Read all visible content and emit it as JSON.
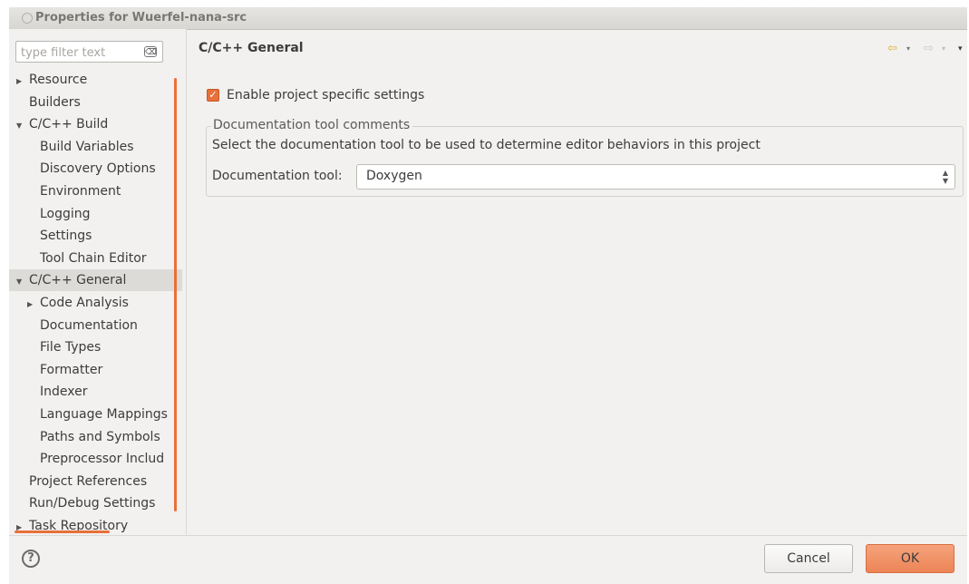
{
  "window": {
    "title": "Properties for Wuerfel-nana-src"
  },
  "filter": {
    "placeholder": "type filter text",
    "clear_glyph": "⌫"
  },
  "tree": [
    {
      "label": "Resource",
      "expander": "collapsed",
      "level": 0
    },
    {
      "label": "Builders",
      "expander": "none",
      "level": 0
    },
    {
      "label": "C/C++ Build",
      "expander": "expanded",
      "level": 0
    },
    {
      "label": "Build Variables",
      "expander": "none",
      "level": 1
    },
    {
      "label": "Discovery Options",
      "expander": "none",
      "level": 1
    },
    {
      "label": "Environment",
      "expander": "none",
      "level": 1
    },
    {
      "label": "Logging",
      "expander": "none",
      "level": 1
    },
    {
      "label": "Settings",
      "expander": "none",
      "level": 1
    },
    {
      "label": "Tool Chain Editor",
      "expander": "none",
      "level": 1
    },
    {
      "label": "C/C++ General",
      "expander": "expanded",
      "level": 0,
      "selected": true
    },
    {
      "label": "Code Analysis",
      "expander": "collapsed",
      "level": 1
    },
    {
      "label": "Documentation",
      "expander": "none",
      "level": 1
    },
    {
      "label": "File Types",
      "expander": "none",
      "level": 1
    },
    {
      "label": "Formatter",
      "expander": "none",
      "level": 1
    },
    {
      "label": "Indexer",
      "expander": "none",
      "level": 1
    },
    {
      "label": "Language Mappings",
      "expander": "none",
      "level": 1
    },
    {
      "label": "Paths and Symbols",
      "expander": "none",
      "level": 1
    },
    {
      "label": "Preprocessor Includ",
      "expander": "none",
      "level": 1
    },
    {
      "label": "Project References",
      "expander": "none",
      "level": 0
    },
    {
      "label": "Run/Debug Settings",
      "expander": "none",
      "level": 0
    },
    {
      "label": "Task Repository",
      "expander": "collapsed",
      "level": 0
    }
  ],
  "main": {
    "title": "C/C++ General",
    "enable_checkbox": {
      "label": "Enable project specific settings",
      "checked": true
    },
    "group": {
      "legend": "Documentation tool comments",
      "description": "Select the documentation tool to be used to determine editor behaviors in this project",
      "tool_label": "Documentation tool:",
      "tool_value": "Doxygen"
    }
  },
  "nav": {
    "back": "⇦",
    "forward": "⇨",
    "dropdown": "▾"
  },
  "footer": {
    "help": "?",
    "cancel_label": "Cancel",
    "ok_label": "OK"
  },
  "colors": {
    "accent": "#e8703a",
    "ok_button": "#ec8556",
    "selection": "#dcdbd8"
  }
}
